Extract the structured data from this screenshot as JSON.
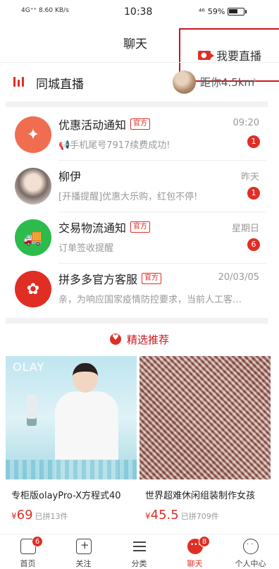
{
  "status_bar": {
    "network": "4G⁺⁺ 8.60 KB/s",
    "time": "10:38",
    "signal": "⁴⁶",
    "battery": "59%"
  },
  "header": {
    "title": "聊天",
    "live_button": "我要直播",
    "live_icon": "camera-icon"
  },
  "local_live": {
    "title": "同城直播",
    "distance": "距你4.5km",
    "chevron": "›"
  },
  "messages": [
    {
      "name": "优惠活动通知",
      "badge": "官方",
      "time": "09:20",
      "preview": "📢手机尾号7917续费成功!",
      "unread": "1",
      "icon": "tag-icon"
    },
    {
      "name": "柳伊",
      "badge": "",
      "time": "昨天",
      "preview": "[开播提醒]优惠大乐购，红包不停!",
      "unread": "1",
      "icon": "user-avatar"
    },
    {
      "name": "交易物流通知",
      "badge": "官方",
      "time": "星期日",
      "preview": "订单签收提醒",
      "unread": "6",
      "icon": "truck-icon"
    },
    {
      "name": "拼多多官方客服",
      "badge": "官方",
      "time": "20/03/05",
      "preview": "亲，为响应国家疫情防控要求，当前人工客…",
      "unread": "",
      "icon": "pdd-logo"
    }
  ],
  "recommend": {
    "title": "精选推荐"
  },
  "products": [
    {
      "title": "专柜版olayPro-X方程式40",
      "currency": "¥",
      "price": "69",
      "sold": "已拼13件",
      "brand": "OLAY"
    },
    {
      "title": "世界超难休闲组装制作女孩",
      "currency": "¥",
      "price": "45.5",
      "sold": "已拼709件"
    }
  ],
  "tabbar": [
    {
      "label": "首页",
      "badge": "6"
    },
    {
      "label": "关注",
      "badge": ""
    },
    {
      "label": "分类",
      "badge": ""
    },
    {
      "label": "聊天",
      "badge": "8"
    },
    {
      "label": "个人中心",
      "badge": ""
    }
  ],
  "colors": {
    "accent": "#e02e24",
    "highlight_box": "#c8161d"
  }
}
